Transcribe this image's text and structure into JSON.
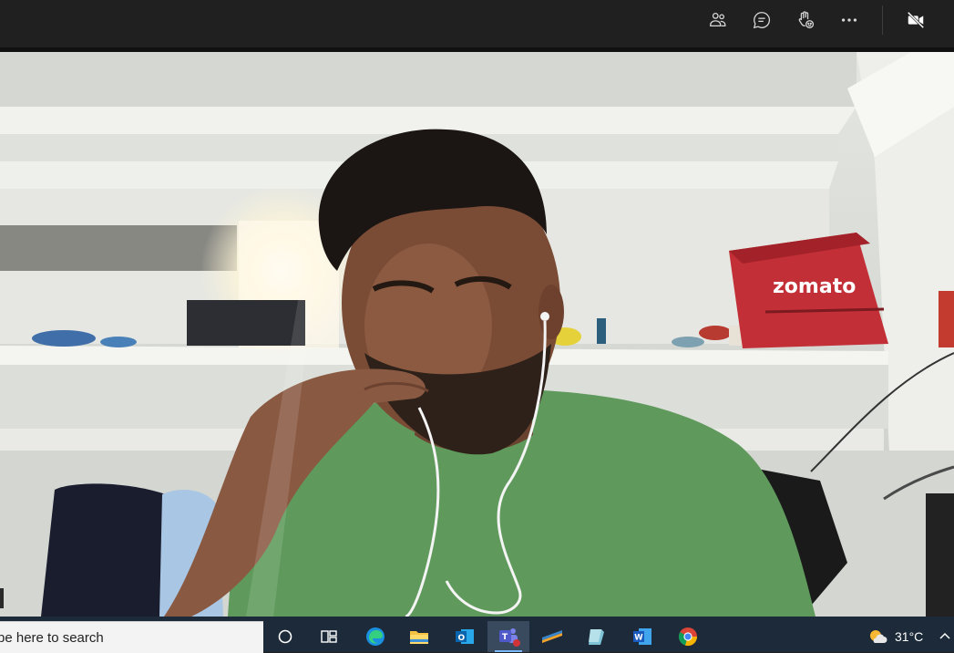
{
  "toolbar": {
    "buttons": [
      {
        "name": "participants-icon"
      },
      {
        "name": "chat-icon"
      },
      {
        "name": "reactions-icon"
      },
      {
        "name": "more-options-icon"
      },
      {
        "name": "camera-off-icon"
      }
    ]
  },
  "video": {
    "bag_logo_text": "zomato"
  },
  "taskbar": {
    "search_placeholder": "pe here to search",
    "apps": [
      "cortana-icon",
      "task-view-icon",
      "edge-icon",
      "file-explorer-icon",
      "outlook-icon",
      "teams-icon",
      "app-icon",
      "notes-icon",
      "word-icon",
      "chrome-icon"
    ],
    "active_app": "teams-icon",
    "weather": {
      "temperature": "31°C",
      "icon": "sun-cloud-icon"
    }
  },
  "colors": {
    "toolbar_bg": "#202020",
    "taskbar_bg": "#1c2a39",
    "shirt": "#5f9a5c",
    "bag": "#c32f37"
  }
}
